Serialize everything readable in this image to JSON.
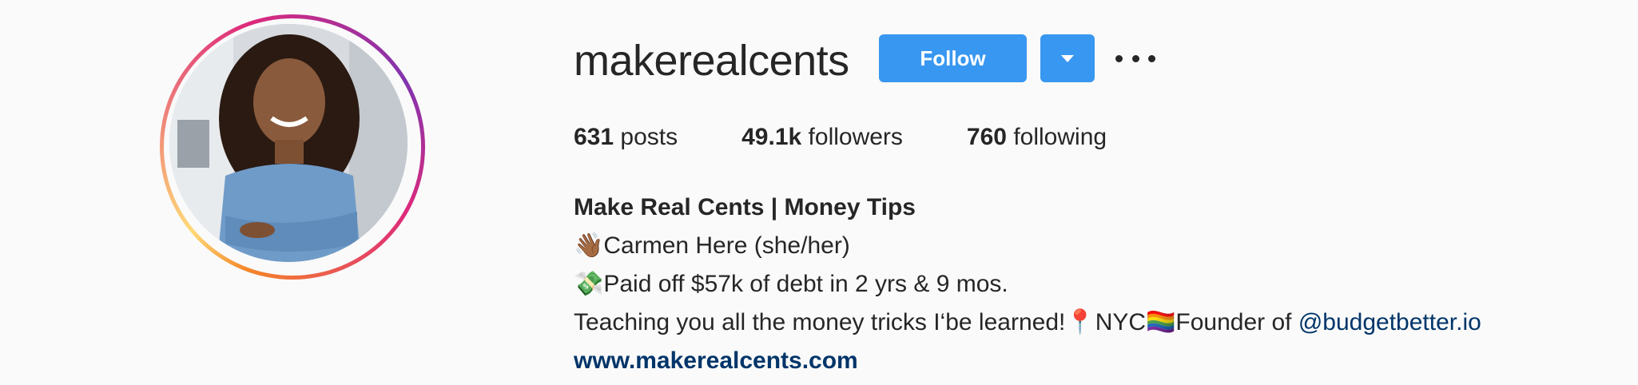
{
  "profile": {
    "username": "makerealcents",
    "follow_label": "Follow"
  },
  "stats": {
    "posts_count": "631",
    "posts_label": "posts",
    "followers_count": "49.1k",
    "followers_label": "followers",
    "following_count": "760",
    "following_label": "following"
  },
  "bio": {
    "name": "Make Real Cents | Money Tips",
    "line1_emoji": "👋🏾",
    "line1_text": "Carmen Here (she/her)",
    "line2_emoji": "💸",
    "line2_text": "Paid off $57k of debt in 2 yrs & 9 mos.",
    "line3_text": "Teaching you all the money tricks I‘be learned!",
    "line3_pin": "📍",
    "line3_city": "NYC",
    "line3_flag": "🏳️‍🌈",
    "line3_founder": "Founder of ",
    "mention": "@budgetbetter.io",
    "website": "www.makerealcents.com"
  },
  "icons": {
    "dropdown": "chevron-down-icon",
    "more": "more-options-icon"
  },
  "colors": {
    "follow_button": "#3897f0",
    "link": "#003569",
    "text": "#262626",
    "background": "#fafafa"
  }
}
